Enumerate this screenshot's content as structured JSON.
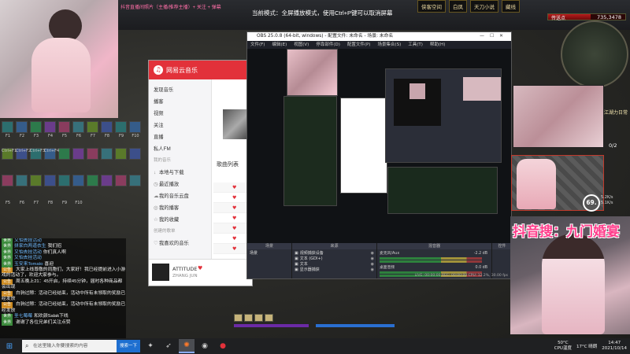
{
  "stream": {
    "marquee": "抖音直播间照片（主播/推荐主播）+ 关注 + 弹幕",
    "fullscreen_hint": "当前模式：全屏播放模式，使用Ctrl+P键可以取消屏幕"
  },
  "game": {
    "top_buttons": [
      "侠客空间",
      "白凤",
      "天刀小说",
      "藏线"
    ],
    "hp_label": "传送点",
    "hp_value": "735,3478",
    "hp_fraction": 0.55,
    "quest_text": "江湖力日常",
    "progress": "0/2",
    "skill_keys_row1": [
      "F1",
      "F2",
      "F3",
      "F4",
      "F5",
      "F6",
      "F7",
      "F8",
      "F9",
      "F10"
    ],
    "skill_keys_row2": [
      "Ctrl+F1",
      "Ctrl+F2",
      "Ctrl+F3",
      "Ctrl+F4"
    ],
    "skill_keys_row3": [
      "F5",
      "F6",
      "F7",
      "F8",
      "F9",
      "F10"
    ]
  },
  "chat": [
    {
      "tag": "世界",
      "sys": false,
      "name": "又怕去挂活动",
      "text": ""
    },
    {
      "tag": "世界",
      "sys": false,
      "name": "拼家白两道衣生",
      "text": "我们招"
    },
    {
      "tag": "世界",
      "sys": false,
      "name": "又怕去挂活动",
      "text": "你们真人啊"
    },
    {
      "tag": "世界",
      "sys": false,
      "name": "又怕去挂活动",
      "text": ""
    },
    {
      "tag": "世界",
      "sys": false,
      "name": "玉安来Tomato",
      "text": "喜迎"
    },
    {
      "tag": "公告",
      "sys": true,
      "name": "",
      "text": "大家上线尊敬的同胞们，大家好！我已经提前进入小游戏的活动了，欢迎大家参与。"
    },
    {
      "tag": "公告",
      "sys": true,
      "name": "",
      "text": "周五晚上21：45开启，持续45分钟，届时各种商品都会出现"
    },
    {
      "tag": "公告",
      "sys": true,
      "name": "",
      "text": "白驹过隙：活动已经结束，活动中所有未领取的奖励已经发放"
    },
    {
      "tag": "公告",
      "sys": true,
      "name": "",
      "text": "白驹过隙：活动已经结束，活动中所有未领取的奖励已经发放"
    },
    {
      "tag": "世界",
      "sys": false,
      "name": "圣七莓莓",
      "text": "和欢颜Salak下线"
    },
    {
      "tag": "世界",
      "sys": false,
      "name": "",
      "text": "谢谢了各位兄弟们关注点赞"
    }
  ],
  "music": {
    "app_name": "网易云音乐",
    "nav": [
      "发现音乐",
      "播客",
      "视频",
      "关注",
      "直播",
      "私人FM"
    ],
    "section_mine": "我的音乐",
    "mine_items": [
      "本地与下载",
      "最近播放",
      "我的音乐云盘",
      "我的播客",
      "我的收藏"
    ],
    "section_created": "创建的歌单",
    "liked": "我喜欢的音乐",
    "list_title": "歌曲列表",
    "song_title": "ATTITUDE",
    "song_artist": "ZHANG JUN"
  },
  "obs": {
    "title": "OBS 25.0.8 (64-bit, windows) - 配置文件: 未命名 - 场景: 未命名",
    "menu": [
      "文件(F)",
      "编辑(E)",
      "视图(V)",
      "停靠部件(D)",
      "配置文件(P)",
      "场景集合(S)",
      "工具(T)",
      "帮助(H)"
    ],
    "docks": {
      "scenes": "场景",
      "sources": "来源",
      "mixer": "混音器",
      "transitions": "转场特效",
      "controls": "控件"
    },
    "scene_item": "场景",
    "sources": [
      "视频捕获设备",
      "文本 (GDI+)",
      "文本",
      "显示器捕获"
    ],
    "mixer_tracks": [
      "麦克风/Aux",
      "桌面音频"
    ],
    "mixer_db": [
      "-2.2 dB",
      "0.0 dB"
    ],
    "status": "LIVE: 00:00:00  REC: 00:00:00  CPU: 12.2%, 30.00 fps"
  },
  "overlay": {
    "douyin_text": "抖音搜：九门婚宴",
    "circle_value": "69.",
    "circle_sub": "5.2K/s\n5.1K/s"
  },
  "taskbar": {
    "search_placeholder": "在这里输入你要搜索的内容",
    "search_button": "搜索一下",
    "temperature": "50°C",
    "cpu_label": "CPU温度",
    "weather": "17°C 晴朗",
    "time": "14:47",
    "date": "2021/10/14"
  }
}
